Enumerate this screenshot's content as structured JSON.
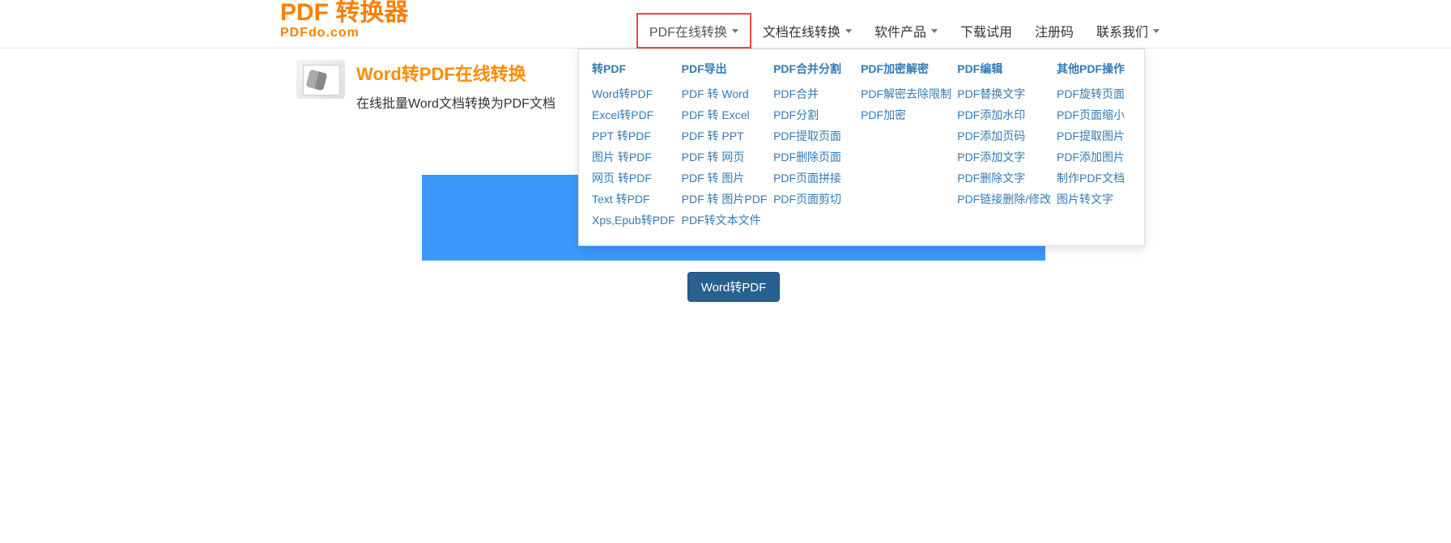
{
  "logo": {
    "title": "PDF 转换器",
    "sub": "PDFdo.com"
  },
  "nav": {
    "pdf_online": "PDF在线转换",
    "doc_online": "文档在线转换",
    "software": "软件产品",
    "download": "下载试用",
    "register": "注册码",
    "contact": "联系我们"
  },
  "dropdown": {
    "cols": [
      {
        "header": "转PDF",
        "items": [
          "Word转PDF",
          "Excel转PDF",
          "PPT 转PDF",
          "图片 转PDF",
          "网页 转PDF",
          "Text 转PDF",
          "Xps,Epub转PDF"
        ]
      },
      {
        "header": "PDF导出",
        "items": [
          "PDF 转 Word",
          "PDF 转 Excel",
          "PDF 转 PPT",
          "PDF 转 网页",
          "PDF 转 图片",
          "PDF 转 图片PDF",
          "PDF转文本文件"
        ]
      },
      {
        "header": "PDF合并分割",
        "items": [
          "PDF合并",
          "PDF分割",
          "PDF提取页面",
          "PDF删除页面",
          "PDF页面拼接",
          "PDF页面剪切"
        ]
      },
      {
        "header": "PDF加密解密",
        "items": [
          "PDF解密去除限制",
          "PDF加密"
        ]
      },
      {
        "header": "PDF编辑",
        "items": [
          "PDF替换文字",
          "PDF添加水印",
          "PDF添加页码",
          "PDF添加文字",
          "PDF删除文字",
          "PDF链接删除/修改"
        ]
      },
      {
        "header": "其他PDF操作",
        "items": [
          "PDF旋转页面",
          "PDF页面缩小",
          "PDF提取图片",
          "PDF添加图片",
          "制作PDF文档",
          "图片转文字"
        ]
      }
    ]
  },
  "page": {
    "title": "Word转PDF在线转换",
    "desc": "在线批量Word文档转换为PDF文档"
  },
  "buttons": {
    "convert": "Word转PDF"
  }
}
